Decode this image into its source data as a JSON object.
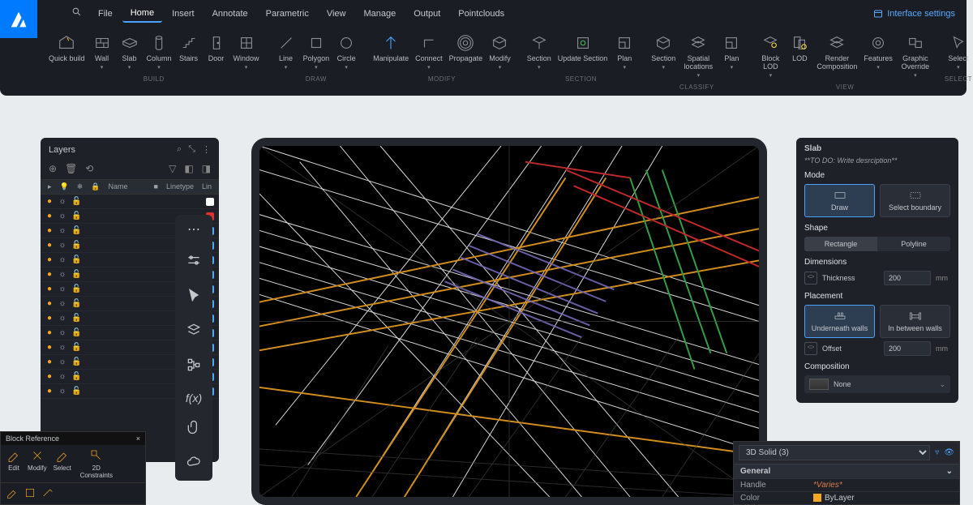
{
  "menu": [
    "File",
    "Home",
    "Insert",
    "Annotate",
    "Parametric",
    "View",
    "Manage",
    "Output",
    "Pointclouds"
  ],
  "menu_active": "Home",
  "interface_settings": "Interface settings",
  "groups": {
    "build": {
      "label": "BUILD",
      "items": [
        "Quick build",
        "Wall",
        "Slab",
        "Column",
        "Stairs",
        "Door",
        "Window"
      ]
    },
    "draw": {
      "label": "DRAW",
      "items": [
        "Line",
        "Polygon",
        "Circle"
      ]
    },
    "modify": {
      "label": "MODIFY",
      "items": [
        "Manipulate",
        "Connect",
        "Propagate",
        "Modify"
      ]
    },
    "section": {
      "label": "SECTION",
      "items": [
        "Section",
        "Update Section",
        "Plan"
      ]
    },
    "classify": {
      "label": "CLASSIFY",
      "items": [
        "Section",
        "Spatial locations",
        "Plan"
      ]
    },
    "view": {
      "label": "VIEW",
      "items": [
        "Block LOD",
        "LOD",
        "Render Composition",
        "Features",
        "Graphic Override"
      ]
    },
    "select": {
      "label": "SELECT",
      "items": [
        "Select"
      ]
    }
  },
  "layers": {
    "title": "Layers",
    "columns": [
      "",
      "",
      "",
      "",
      "Name",
      "",
      "Linetype",
      "Lin"
    ],
    "row_swatches": [
      "#ffffff",
      "#e03131",
      "#4dabf7",
      "#4dabf7",
      "#4dabf7",
      "#4dabf7",
      "#4dabf7",
      "#4dabf7",
      "#4dabf7",
      "#4dabf7",
      "#4dabf7",
      "#4dabf7",
      "#4dabf7",
      "#4dabf7"
    ]
  },
  "slab": {
    "title": "Slab",
    "todo": "**TO DO: Write desrciption**",
    "mode_label": "Mode",
    "mode_draw": "Draw",
    "mode_boundary": "Select boundary",
    "shape_label": "Shape",
    "shape_rect": "Rectangle",
    "shape_poly": "Polyline",
    "dim_label": "Dimensions",
    "thickness_label": "Thickness",
    "thickness_value": "200",
    "unit": "mm",
    "placement_label": "Placement",
    "placement_under": "Underneath walls",
    "placement_between": "In between walls",
    "offset_label": "Offset",
    "offset_value": "200",
    "composition_label": "Composition",
    "composition_value": "None"
  },
  "blockref": {
    "title": "Block Reference",
    "items": [
      "Edit",
      "Modify",
      "Select",
      "2D Constraints"
    ]
  },
  "solid": {
    "title": "3D Solid (3)",
    "group": "General",
    "handle_k": "Handle",
    "handle_v": "*Varies*",
    "color_k": "Color",
    "color_v": "ByLayer"
  }
}
